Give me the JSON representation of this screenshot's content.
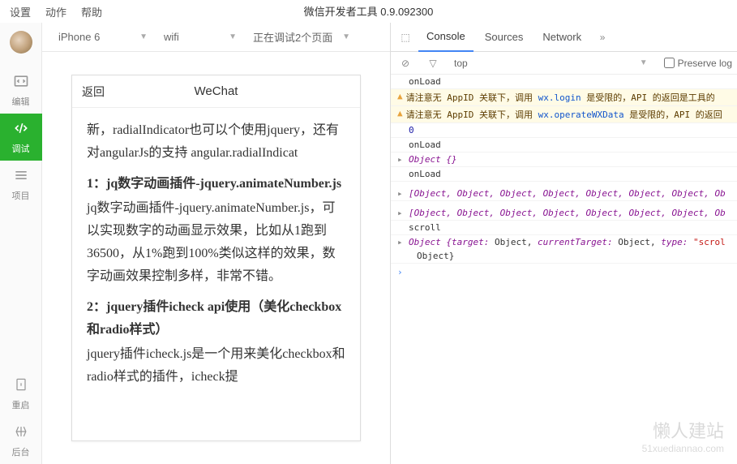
{
  "menu": {
    "settings": "设置",
    "actions": "动作",
    "help": "帮助"
  },
  "title": "微信开发者工具 0.9.092300",
  "sidebar": {
    "edit": "编辑",
    "debug": "调试",
    "project": "项目",
    "restart": "重启",
    "backend": "后台"
  },
  "toolbar": {
    "device": "iPhone 6",
    "network": "wifi",
    "status": "正在调试2个页面"
  },
  "phone": {
    "back": "返回",
    "title": "WeChat",
    "para1": "新，radialIndicator也可以个使用jquery，还有对angularJs的支持 angular.radialIndicat",
    "h1": "1：jq数字动画插件-jquery.animateNumber.js",
    "para2": "jq数字动画插件-jquery.animateNumber.js，可以实现数字的动画显示效果，比如从1跑到36500，从1%跑到100%类似这样的效果，数字动画效果控制多样，非常不错。",
    "h2": "2：jquery插件icheck api使用（美化checkbox和radio样式）",
    "para3": "jquery插件icheck.js是一个用来美化checkbox和radio样式的插件，icheck提"
  },
  "devtools": {
    "tabs": {
      "console": "Console",
      "sources": "Sources",
      "network": "Network"
    },
    "filter": {
      "top": "top",
      "preserve": "Preserve log"
    },
    "logs": {
      "onload1": "onLoad",
      "warn1_pre": "请注意无 AppID 关联下，调用 ",
      "warn1_api": "wx.login",
      "warn1_post": " 是受限的，API 的返回是工具的",
      "warn2_pre": "请注意无 AppID 关联下，调用 ",
      "warn2_api": "wx.operateWXData",
      "warn2_post": " 是受限的，API 的返回",
      "zero": "0",
      "onload2": "onLoad",
      "obj_empty": "Object {}",
      "onload3": "onLoad",
      "objarr": "[Object, Object, Object, Object, Object, Object, Object, Ob",
      "objarr2": "[Object, Object, Object, Object, Object, Object, Object, Ob",
      "scroll": "scroll",
      "scrollobj_pre": "Object {",
      "scrollobj_k1": "target:",
      "scrollobj_v1": " Object",
      "scrollobj_k2": "currentTarget:",
      "scrollobj_v2": " Object",
      "scrollobj_k3": "type:",
      "scrollobj_v3": "\"scrol",
      "scrollobj_line2": "Object}"
    }
  },
  "watermark": {
    "main": "懒人建站",
    "sub": "51xuediannao.com"
  }
}
